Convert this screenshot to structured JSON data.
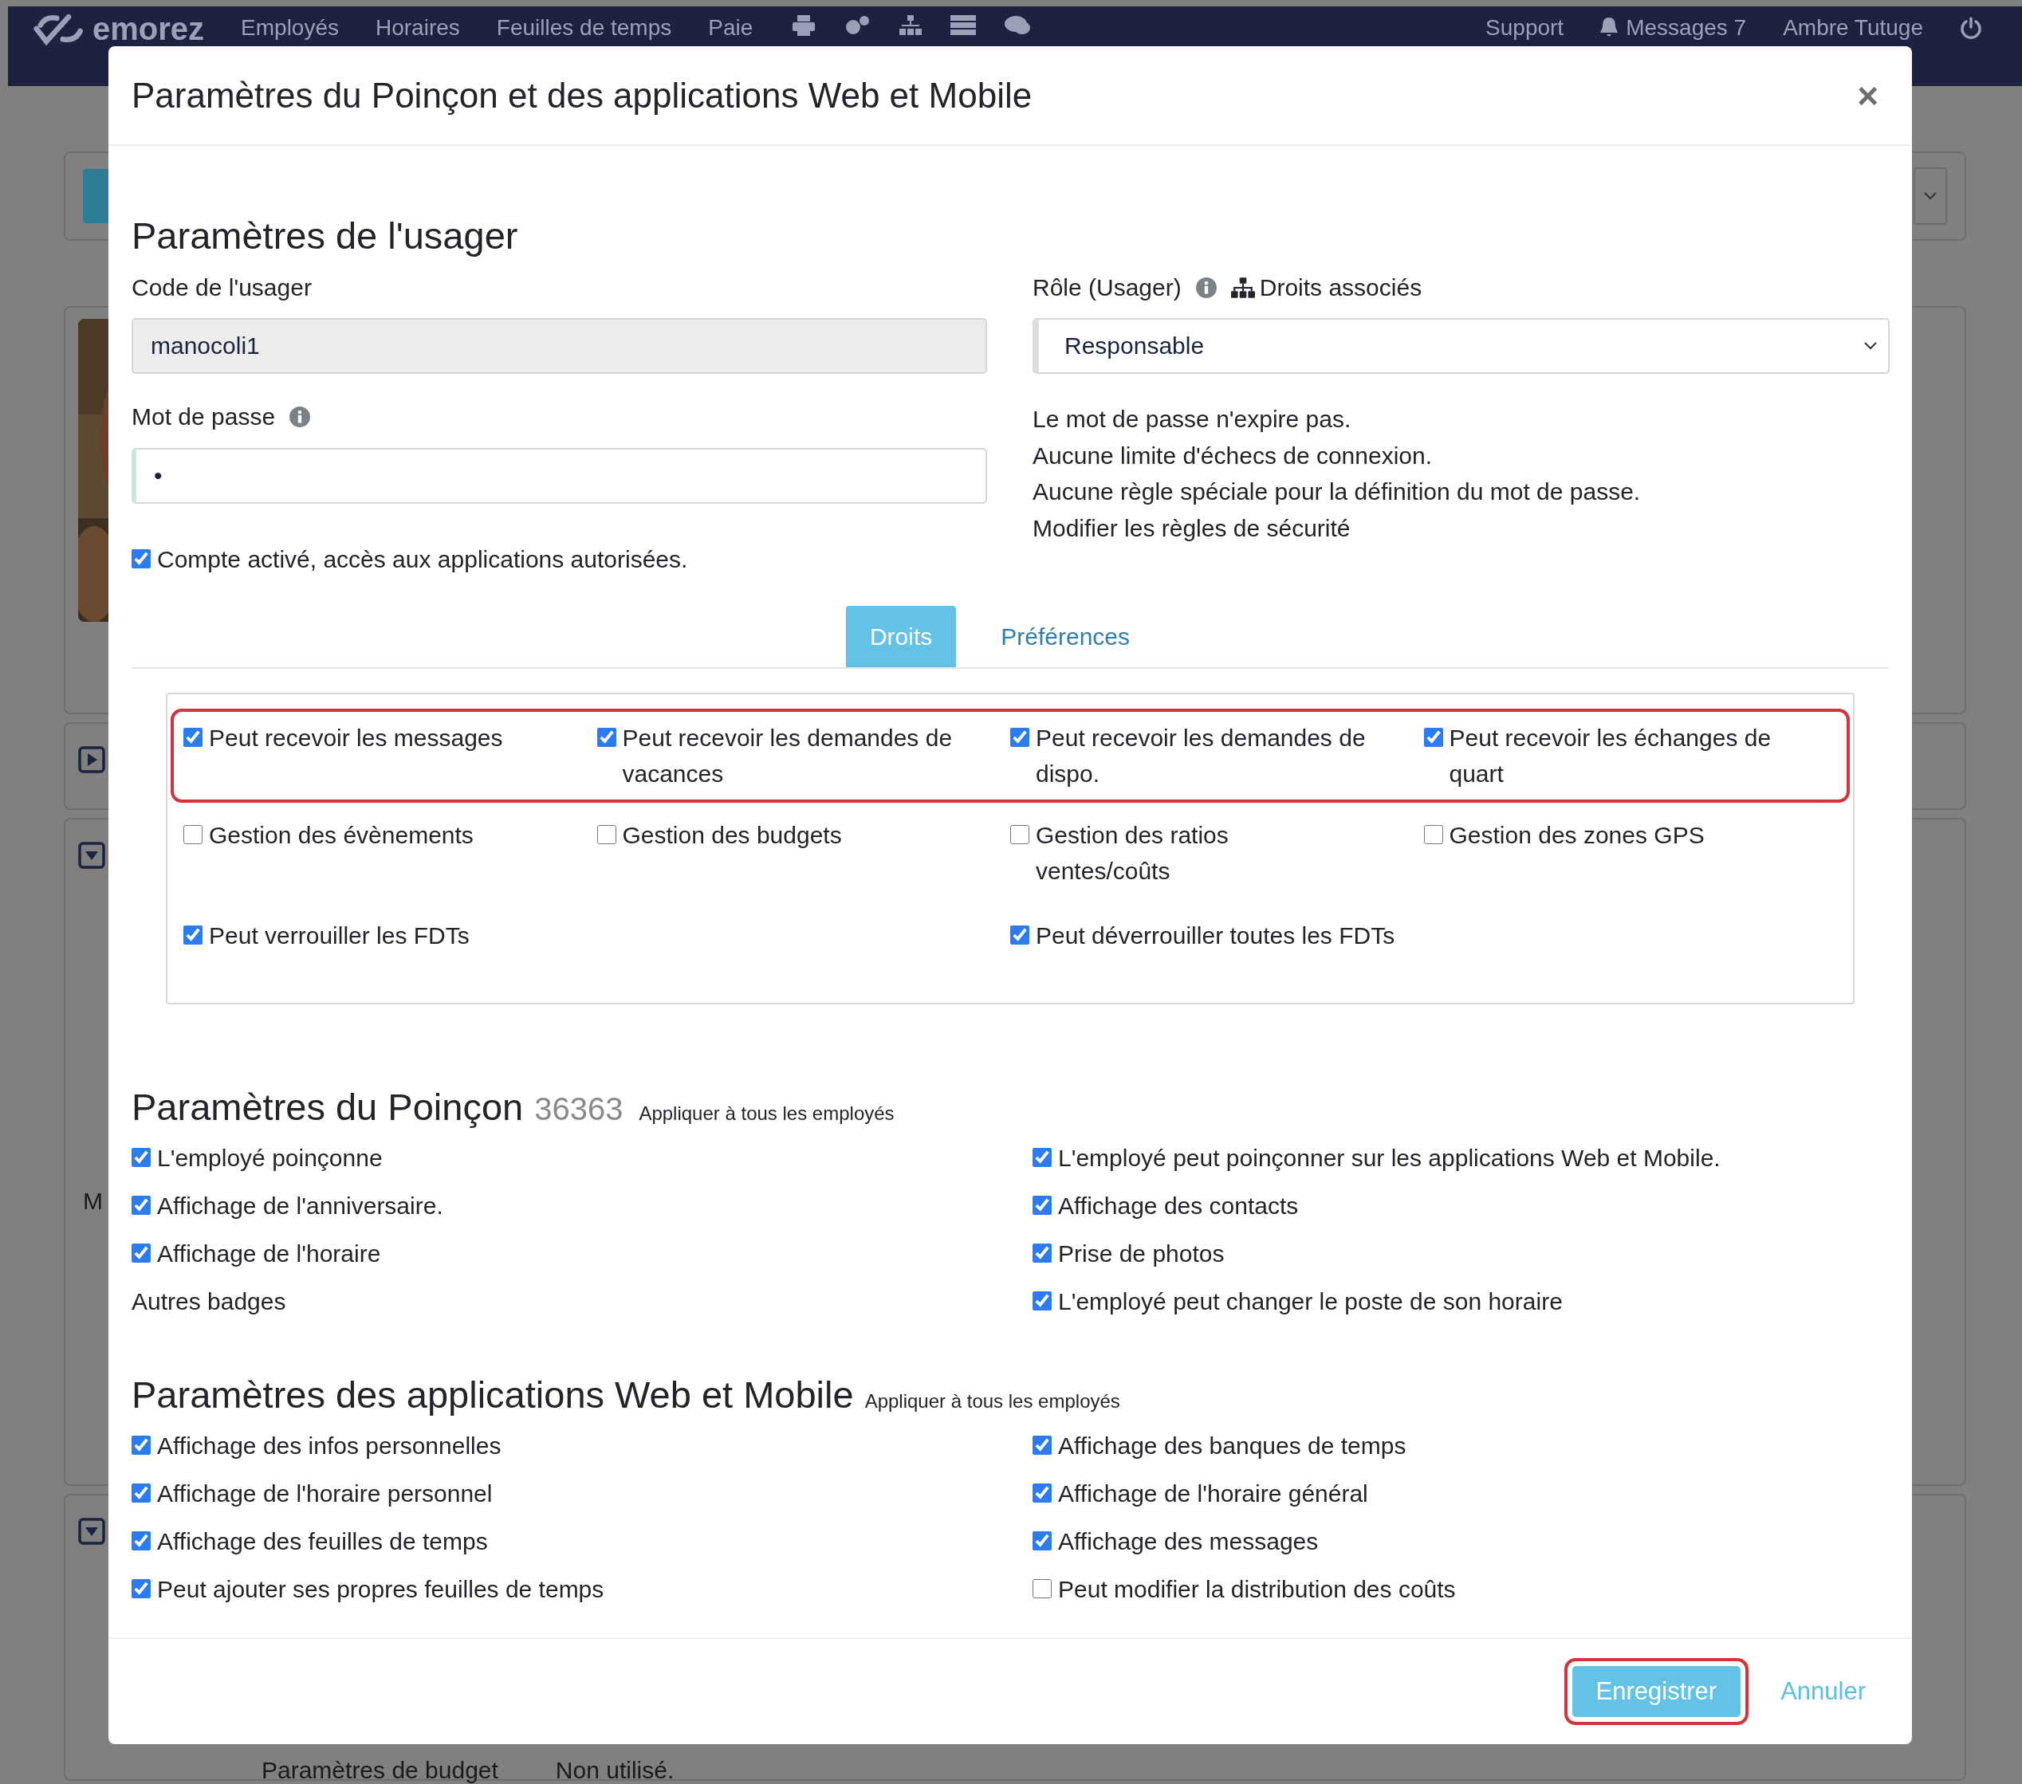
{
  "navbar": {
    "logo": "emorez",
    "items": [
      {
        "label": "Employés"
      },
      {
        "label": "Horaires"
      },
      {
        "label": "Feuilles de temps"
      },
      {
        "label": "Paie"
      }
    ],
    "support": "Support",
    "messages": "Messages 7",
    "user": "Ambre Tutuge"
  },
  "background": {
    "side_letter": "M",
    "budget_label": "Paramètres de budget",
    "budget_value": "Non utilisé."
  },
  "dialog": {
    "title": "Paramètres du Poinçon et des applications Web et Mobile",
    "close": "×",
    "user_section": {
      "heading": "Paramètres de l'usager",
      "code_label": "Code de l'usager",
      "code_value": "manocoli1",
      "password_label": "Mot de passe",
      "password_value": "•",
      "account_active": {
        "label": "Compte activé, accès aux applications autorisées.",
        "checked": true
      },
      "role_label": "Rôle (Usager)",
      "rights_link": "Droits associés",
      "role_value": "Responsable",
      "notes": [
        "Le mot de passe n'expire pas.",
        "Aucune limite d'échecs de connexion.",
        "Aucune règle spéciale pour la définition du mot de passe.",
        "Modifier les règles de sécurité"
      ]
    },
    "tabs": [
      {
        "label": "Droits",
        "selected": true
      },
      {
        "label": "Préférences",
        "selected": false
      }
    ],
    "rights_rows": [
      {
        "highlighted": true,
        "items": [
          {
            "label": "Peut recevoir les messages",
            "checked": true
          },
          {
            "label": "Peut recevoir les demandes de vacances",
            "checked": true
          },
          {
            "label": "Peut recevoir les demandes de dispo.",
            "checked": true
          },
          {
            "label": "Peut recevoir les échanges de quart",
            "checked": true
          }
        ]
      },
      {
        "highlighted": false,
        "items": [
          {
            "label": "Gestion des évènements",
            "checked": false
          },
          {
            "label": "Gestion des budgets",
            "checked": false
          },
          {
            "label": "Gestion des ratios ventes/coûts",
            "checked": false
          },
          {
            "label": "Gestion des zones GPS",
            "checked": false
          }
        ]
      },
      {
        "highlighted": false,
        "items": [
          {
            "label": "Peut verrouiller les FDTs",
            "checked": true
          },
          {
            "label": "Peut déverrouiller toutes les FDTs",
            "checked": true
          }
        ]
      }
    ],
    "punch_section": {
      "heading": "Paramètres du Poinçon",
      "number": "36363",
      "apply_all": "Appliquer à tous les employés",
      "options": [
        {
          "kind": "checkbox",
          "label": "L'employé poinçonne",
          "checked": true
        },
        {
          "kind": "checkbox",
          "label": "L'employé peut poinçonner sur les applications Web et Mobile.",
          "checked": true
        },
        {
          "kind": "checkbox",
          "label": "Affichage de l'anniversaire.",
          "checked": true
        },
        {
          "kind": "checkbox",
          "label": "Affichage des contacts",
          "checked": true
        },
        {
          "kind": "checkbox",
          "label": "Affichage de l'horaire",
          "checked": true
        },
        {
          "kind": "checkbox",
          "label": "Prise de photos",
          "checked": true
        },
        {
          "kind": "text",
          "label": "Autres badges"
        },
        {
          "kind": "checkbox",
          "label": "L'employé peut changer le poste de son horaire",
          "checked": true
        }
      ]
    },
    "apps_section": {
      "heading": "Paramètres des applications Web et Mobile",
      "apply_all": "Appliquer à tous les employés",
      "options": [
        {
          "label": "Affichage des infos personnelles",
          "checked": true
        },
        {
          "label": "Affichage des banques de temps",
          "checked": true
        },
        {
          "label": "Affichage de l'horaire personnel",
          "checked": true
        },
        {
          "label": "Affichage de l'horaire général",
          "checked": true
        },
        {
          "label": "Affichage des feuilles de temps",
          "checked": true
        },
        {
          "label": "Affichage des messages",
          "checked": true
        },
        {
          "label": "Peut ajouter ses propres feuilles de temps",
          "checked": true
        },
        {
          "label": "Peut modifier la distribution des coûts",
          "checked": false
        }
      ]
    },
    "buttons": [
      {
        "label": "Enregistrer",
        "kind": "primary",
        "highlighted": true
      },
      {
        "label": "Annuler",
        "kind": "link",
        "highlighted": false
      }
    ]
  }
}
